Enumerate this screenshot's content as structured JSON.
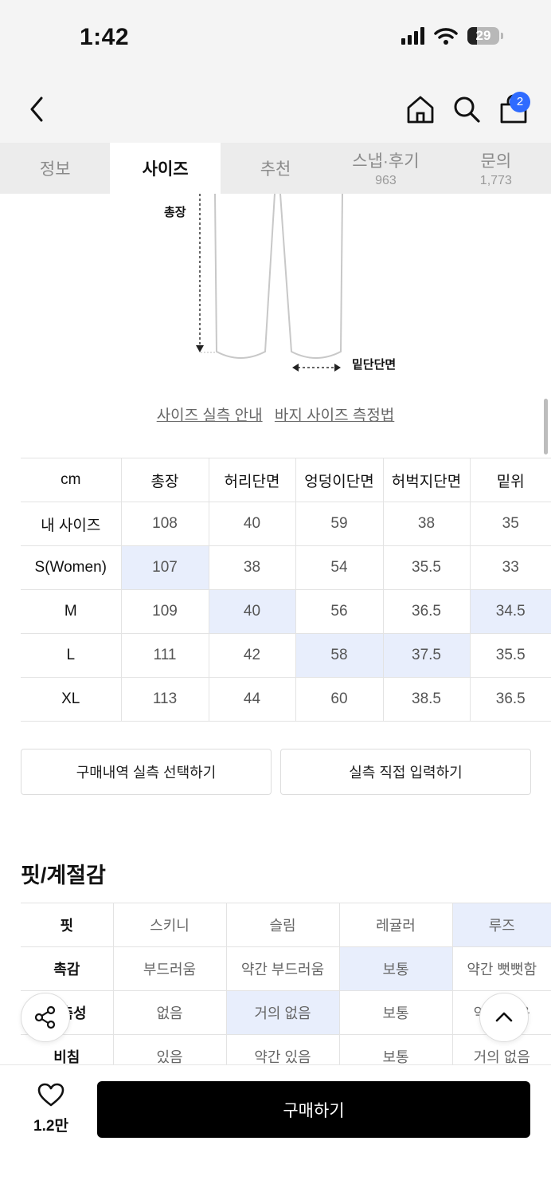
{
  "status_bar": {
    "time": "1:42",
    "battery": "29",
    "battery_level": 0.29
  },
  "nav": {
    "cart_count": "2"
  },
  "tabs": [
    {
      "label": "정보",
      "count": ""
    },
    {
      "label": "사이즈",
      "count": ""
    },
    {
      "label": "추천",
      "count": ""
    },
    {
      "label": "스냅·후기",
      "count": "963"
    },
    {
      "label": "문의",
      "count": "1,773"
    }
  ],
  "diagram": {
    "total_length_label": "총장",
    "hem_label": "밑단단면"
  },
  "links": {
    "size_guide": "사이즈 실측 안내",
    "measure_method": "바지 사이즈 측정법"
  },
  "size_table": {
    "headers": [
      "cm",
      "총장",
      "허리단면",
      "엉덩이단면",
      "허벅지단면",
      "밑위"
    ],
    "rows": [
      [
        "내 사이즈",
        "108",
        "40",
        "59",
        "38",
        "35"
      ],
      [
        "S(Women)",
        "107",
        "38",
        "54",
        "35.5",
        "33"
      ],
      [
        "M",
        "109",
        "40",
        "56",
        "36.5",
        "34.5"
      ],
      [
        "L",
        "111",
        "42",
        "58",
        "37.5",
        "35.5"
      ],
      [
        "XL",
        "113",
        "44",
        "60",
        "38.5",
        "36.5"
      ]
    ]
  },
  "buttons": {
    "purchase_history": "구매내역 실측 선택하기",
    "direct_input": "실측 직접 입력하기",
    "buy": "구매하기"
  },
  "fit_section": {
    "title": "핏/계절감",
    "rows": [
      [
        "핏",
        "스키니",
        "슬림",
        "레귤러",
        "루즈"
      ],
      [
        "촉감",
        "부드러움",
        "약간 부드러움",
        "보통",
        "약간 뻣뻣함"
      ],
      [
        "신축성",
        "없음",
        "거의 없음",
        "보통",
        "약간 있음"
      ],
      [
        "비침",
        "있음",
        "약간 있음",
        "보통",
        "거의 없음"
      ]
    ]
  },
  "like_count": "1.2만",
  "colors": {
    "highlight": "#e8eefc",
    "badge": "#2f6bff",
    "buy_button": "#000000"
  },
  "icons": [
    "back-icon",
    "home-icon",
    "search-icon",
    "cart-icon",
    "share-icon",
    "arrow-up-icon",
    "heart-icon",
    "wifi-icon",
    "signal-icon",
    "battery-icon"
  ]
}
